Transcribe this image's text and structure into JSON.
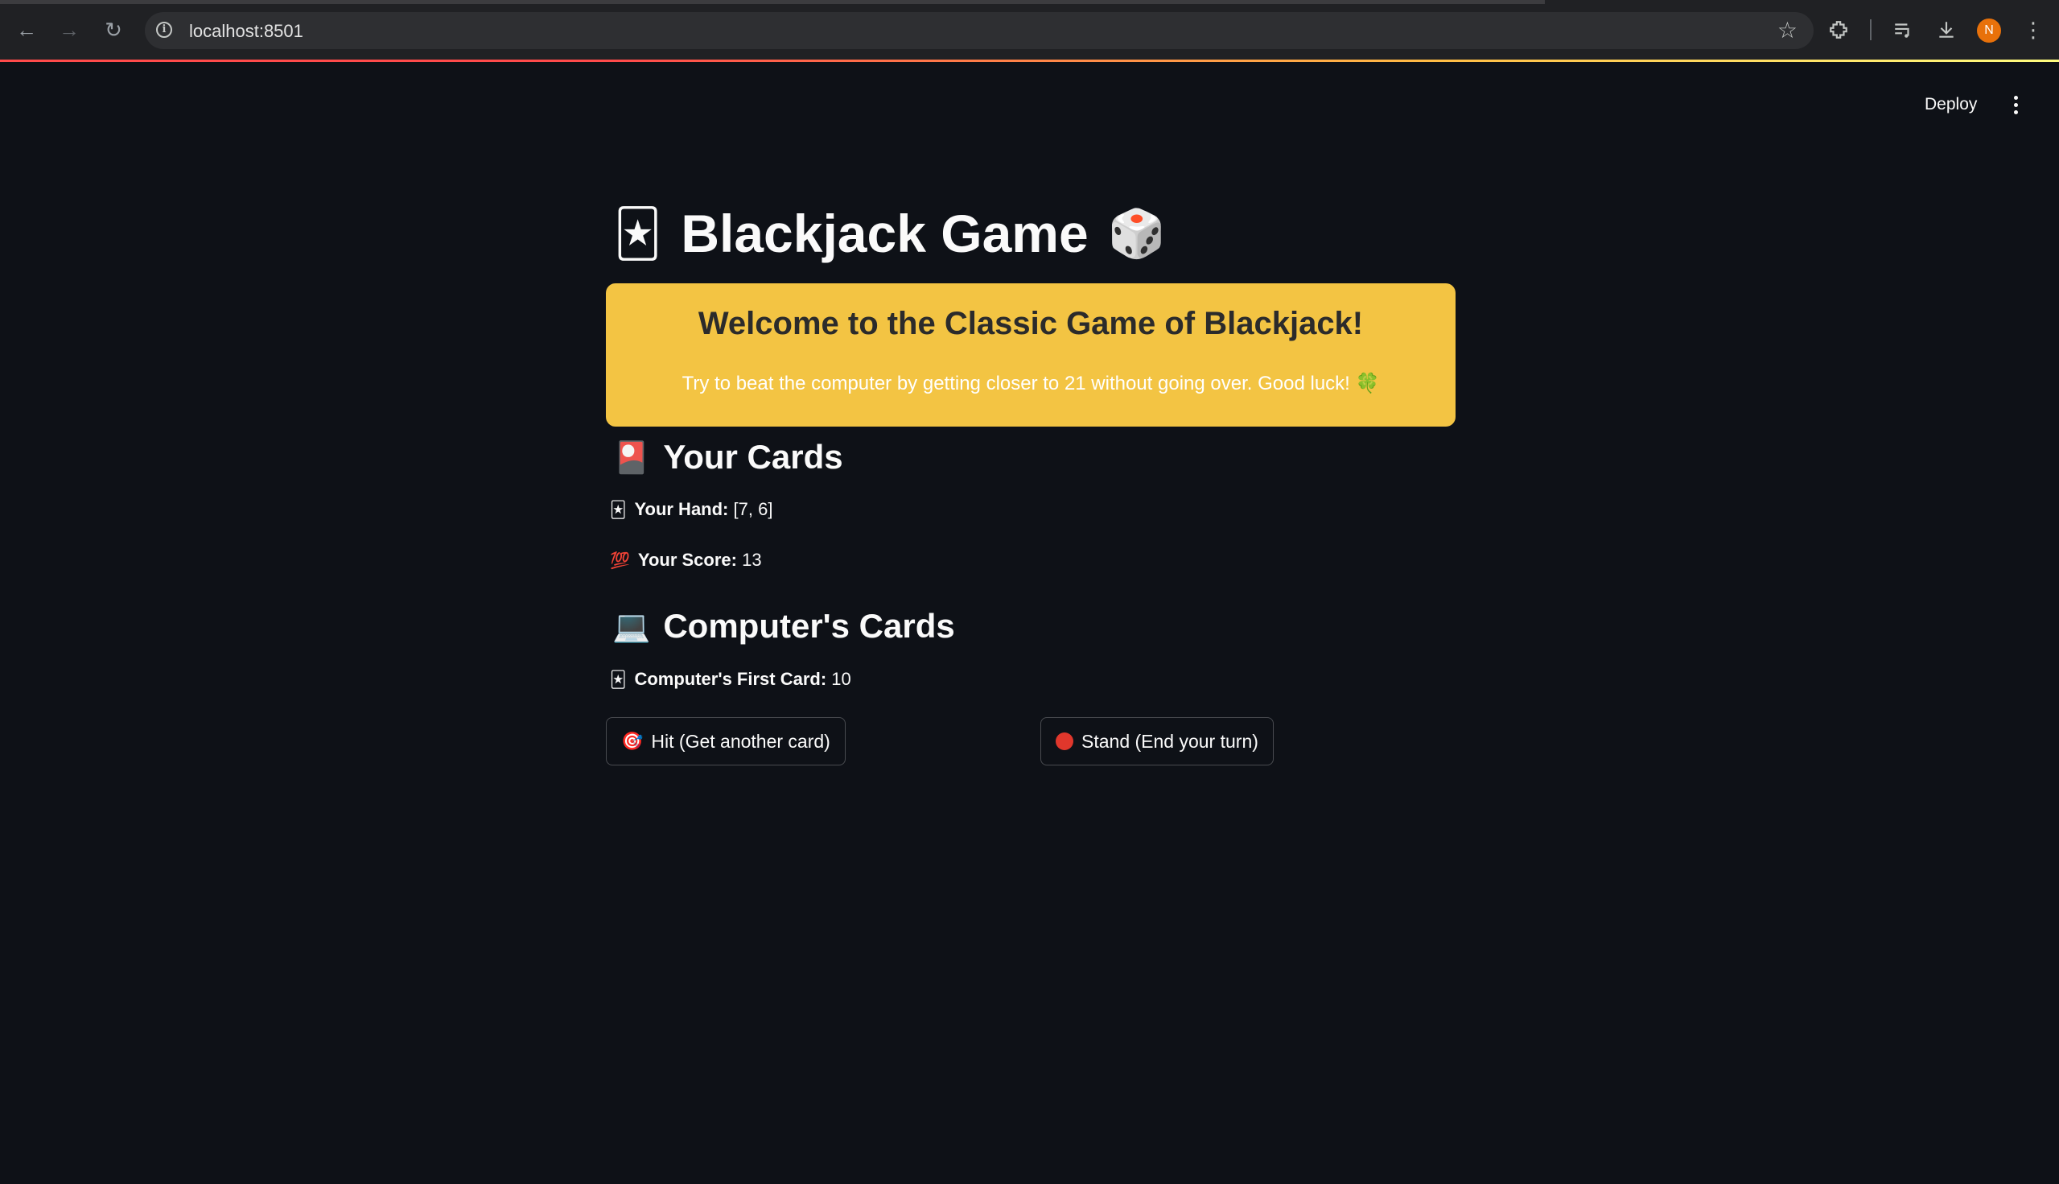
{
  "browser": {
    "url": "localhost:8501",
    "avatar_initial": "N"
  },
  "header": {
    "deploy_label": "Deploy"
  },
  "title": {
    "emoji_left": "🃏",
    "text": "Blackjack Game",
    "emoji_right": "🎲"
  },
  "banner": {
    "heading": "Welcome to the Classic Game of Blackjack!",
    "subtext": "Try to beat the computer by getting closer to 21 without going over. Good luck! 🍀",
    "background": "#f3c443"
  },
  "your_cards": {
    "emoji": "🎴",
    "heading": "Your Cards",
    "hand_emoji": "🃏",
    "hand_label": "Your Hand:",
    "hand_value": "[7, 6]",
    "score_emoji": "💯",
    "score_label": "Your Score:",
    "score_value": "13"
  },
  "computer_cards": {
    "emoji": "💻",
    "heading": "Computer's Cards",
    "first_card_emoji": "🃏",
    "first_card_label": "Computer's First Card:",
    "first_card_value": "10"
  },
  "buttons": {
    "hit_emoji": "🎯",
    "hit_label": "Hit (Get another card)",
    "stand_label": "Stand (End your turn)"
  },
  "colors": {
    "background": "#0e1117",
    "text": "#fafafa",
    "accent": "#ff4b4b"
  }
}
